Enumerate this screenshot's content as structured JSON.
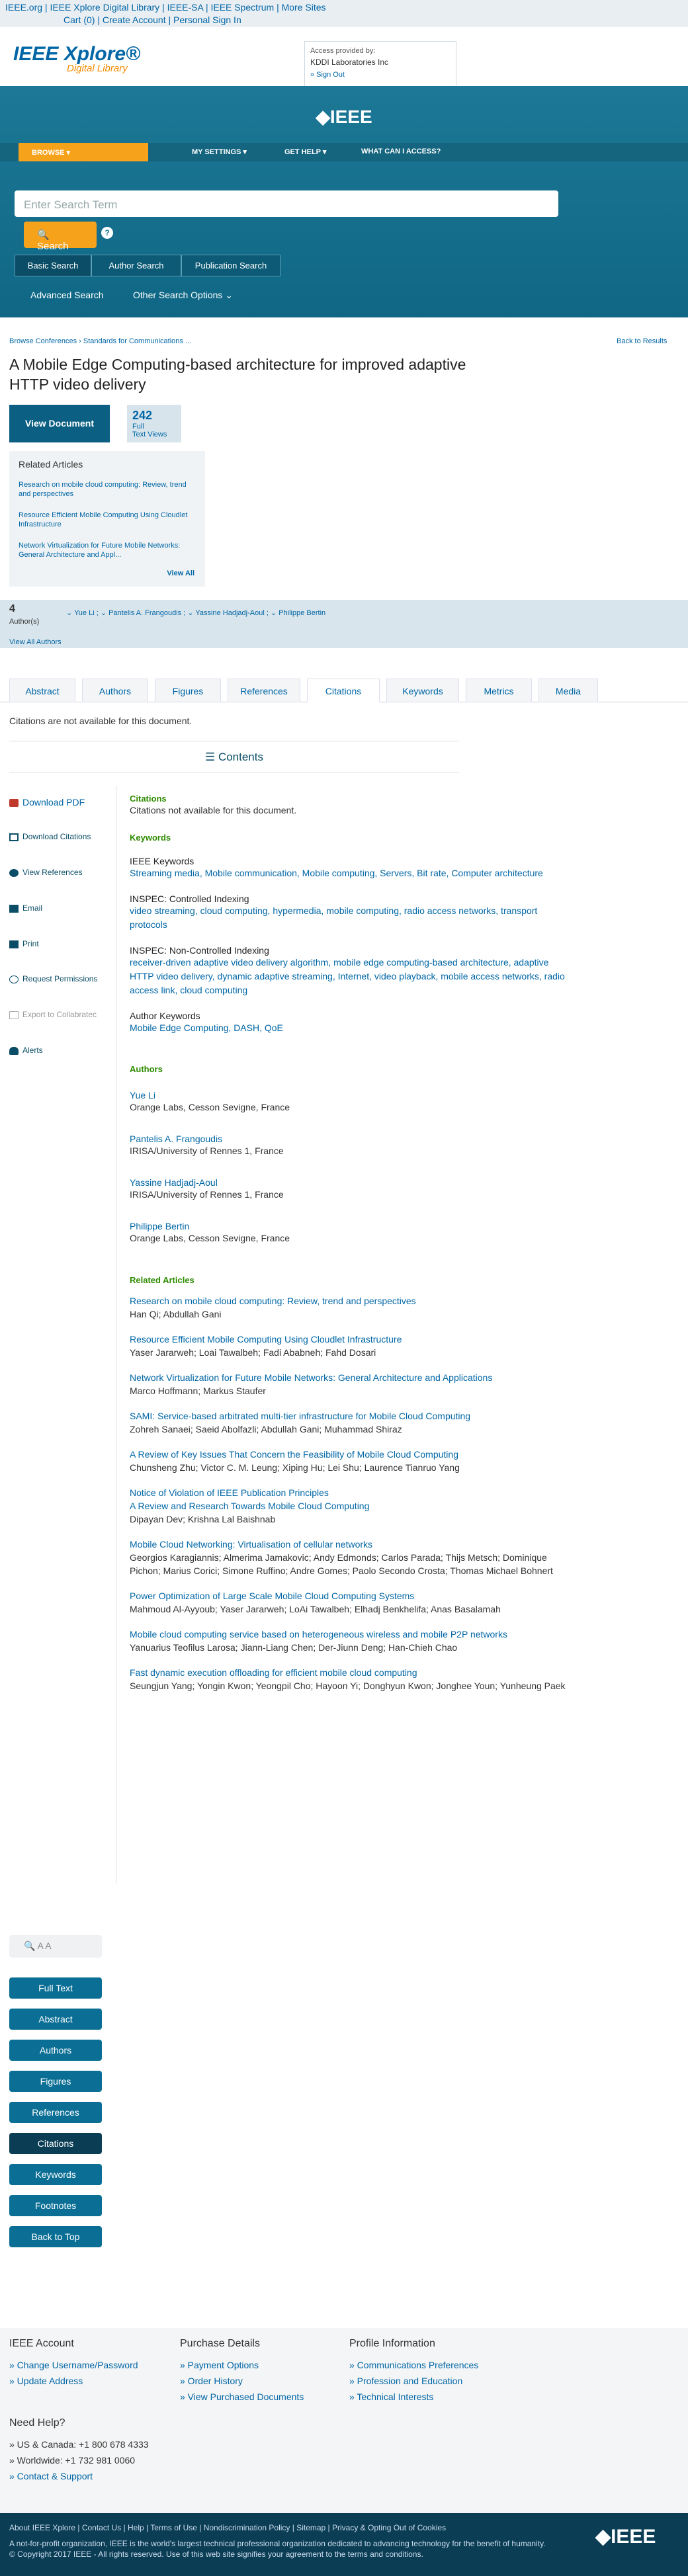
{
  "topbar": {
    "row1": "IEEE.org  |  IEEE Xplore Digital Library  |  IEEE-SA  |  IEEE Spectrum  |  More Sites",
    "row2": "Cart (0)   |   Create Account   |   Personal Sign In"
  },
  "brand": {
    "logo": "IEEE Xplore®",
    "sub": "Digital Library",
    "access_label": "Access provided by:",
    "access_org": "KDDI Laboratories Inc",
    "signout": "» Sign Out",
    "ieee": "◆IEEE"
  },
  "nav": {
    "browse": "BROWSE ▾",
    "settings": "MY SETTINGS ▾",
    "help": "GET HELP ▾",
    "access": "WHAT CAN I ACCESS?"
  },
  "search": {
    "placeholder": "Enter Search Term",
    "button": "Search",
    "help": "?",
    "tabs": [
      "Basic Search",
      "Author Search",
      "Publication Search"
    ],
    "advanced": "Advanced Search",
    "other": "Other Search Options ⌄"
  },
  "crumbs": "Browse Conferences  ›  Standards for Communications ...",
  "back": "Back to Results",
  "title": "A Mobile Edge Computing-based architecture for improved adaptive HTTP video delivery",
  "viewdoc": "View Document",
  "views": {
    "count": "242",
    "label1": "Full",
    "label2": "Text Views"
  },
  "related": {
    "heading": "Related Articles",
    "items": [
      "Research on mobile cloud computing: Review, trend and perspectives",
      "Resource Efficient Mobile Computing Using Cloudlet Infrastructure",
      "Network Virtualization for Future Mobile Networks: General Architecture and Appl..."
    ],
    "view_all": "View All"
  },
  "authors_bar": {
    "count": "4",
    "label": "Author(s)",
    "list": "⌄ Yue Li ; ⌄ Pantelis A. Frangoudis ; ⌄ Yassine Hadjadj-Aoul ; ⌄ Philippe Bertin",
    "view_all": "View All Authors"
  },
  "tabs": [
    "Abstract",
    "Authors",
    "Figures",
    "References",
    "Citations",
    "Keywords",
    "Metrics",
    "Media"
  ],
  "cna": "Citations are not available for this document.",
  "contents": "☰  Contents",
  "left": {
    "download_pdf": "Download PDF",
    "download_citations": "Download Citations",
    "view_references": "View References",
    "email": "Email",
    "print": "Print",
    "request_permissions": "Request Permissions",
    "export": "Export to Collabratec",
    "alerts": "Alerts"
  },
  "citations": {
    "heading": "Citations",
    "text": "Citations not available for this document."
  },
  "keywords": {
    "heading": "Keywords",
    "ieee_h": "IEEE Keywords",
    "ieee": "Streaming media, Mobile communication, Mobile computing, Servers, Bit rate, Computer architecture",
    "inspec_c_h": "INSPEC: Controlled Indexing",
    "inspec_c": "video streaming, cloud computing, hypermedia, mobile computing, radio access networks, transport protocols",
    "inspec_n_h": "INSPEC: Non-Controlled Indexing",
    "inspec_n": "receiver-driven adaptive video delivery algorithm, mobile edge computing-based architecture, adaptive HTTP video delivery, dynamic adaptive streaming, Internet, video playback, mobile access networks, radio access link, cloud computing",
    "author_h": "Author Keywords",
    "author": "Mobile Edge Computing, DASH, QoE"
  },
  "authors": {
    "heading": "Authors",
    "list": [
      {
        "name": "Yue Li",
        "aff": "Orange Labs, Cesson Sevigne, France"
      },
      {
        "name": "Pantelis A. Frangoudis",
        "aff": "IRISA/University of Rennes 1, France"
      },
      {
        "name": "Yassine Hadjadj-Aoul",
        "aff": "IRISA/University of Rennes 1, France"
      },
      {
        "name": "Philippe Bertin",
        "aff": "Orange Labs, Cesson Sevigne, France"
      }
    ]
  },
  "related_articles": {
    "heading": "Related Articles",
    "list": [
      {
        "title": "Research on mobile cloud computing: Review, trend and perspectives",
        "authors": "Han Qi; Abdullah Gani"
      },
      {
        "title": "Resource Efficient Mobile Computing Using Cloudlet Infrastructure",
        "authors": "Yaser Jararweh; Loai Tawalbeh; Fadi Ababneh; Fahd Dosari"
      },
      {
        "title": "Network Virtualization for Future Mobile Networks: General Architecture and Applications",
        "authors": "Marco Hoffmann; Markus Staufer"
      },
      {
        "title": "SAMI: Service-based arbitrated multi-tier infrastructure for Mobile Cloud Computing",
        "authors": "Zohreh Sanaei; Saeid Abolfazli; Abdullah Gani; Muhammad Shiraz"
      },
      {
        "title": "A Review of Key Issues That Concern the Feasibility of Mobile Cloud Computing",
        "authors": "Chunsheng Zhu; Victor C. M. Leung; Xiping Hu; Lei Shu; Laurence Tianruo Yang"
      },
      {
        "title": "Notice of Violation of IEEE Publication Principles\nA Review and Research Towards Mobile Cloud Computing",
        "authors": "Dipayan Dev; Krishna Lal Baishnab"
      },
      {
        "title": "Mobile Cloud Networking: Virtualisation of cellular networks",
        "authors": "Georgios Karagiannis; Almerima Jamakovic; Andy Edmonds; Carlos Parada; Thijs Metsch; Dominique Pichon; Marius Corici; Simone Ruffino; Andre Gomes; Paolo Secondo Crosta; Thomas Michael Bohnert"
      },
      {
        "title": "Power Optimization of Large Scale Mobile Cloud Computing Systems",
        "authors": "Mahmoud Al-Ayyoub; Yaser Jararweh; LoAi Tawalbeh; Elhadj Benkhelifa; Anas Basalamah"
      },
      {
        "title": "Mobile cloud computing service based on heterogeneous wireless and mobile P2P networks",
        "authors": "Yanuarius Teofilus Larosa; Jiann-Liang Chen; Der-Jiunn Deng; Han-Chieh Chao"
      },
      {
        "title": "Fast dynamic execution offloading for efficient mobile cloud computing",
        "authors": "Seungjun Yang; Yongin Kwon; Yeongpil Cho; Hayoon Yi; Donghyun Kwon; Jonghee Youn; Yunheung Paek"
      }
    ]
  },
  "sidenav": {
    "tools": "🔍   A A",
    "buttons": [
      "Full Text",
      "Abstract",
      "Authors",
      "Figures",
      "References",
      "Citations",
      "Keywords",
      "Footnotes",
      "Back to Top"
    ]
  },
  "footer": {
    "account_h": "IEEE Account",
    "account": [
      "» Change Username/Password",
      "» Update Address"
    ],
    "purchase_h": "Purchase Details",
    "purchase": [
      "» Payment Options",
      "» Order History",
      "» View Purchased Documents"
    ],
    "profile_h": "Profile Information",
    "profile": [
      "» Communications Preferences",
      "» Profession and Education",
      "» Technical Interests"
    ],
    "help_h": "Need Help?",
    "help": [
      "» US & Canada: +1 800 678 4333",
      "» Worldwide: +1 732 981 0060",
      "» Contact & Support"
    ],
    "links": "About IEEE Xplore | Contact Us | Help | Terms of Use | Nondiscrimination Policy | Sitemap | Privacy & Opting Out of Cookies",
    "note1": "A not-for-profit organization, IEEE is the world's largest technical professional organization dedicated to advancing technology for the benefit of humanity.",
    "note2": "© Copyright 2017 IEEE - All rights reserved. Use of this web site signifies your agreement to the terms and conditions.",
    "logo": "◆IEEE"
  }
}
